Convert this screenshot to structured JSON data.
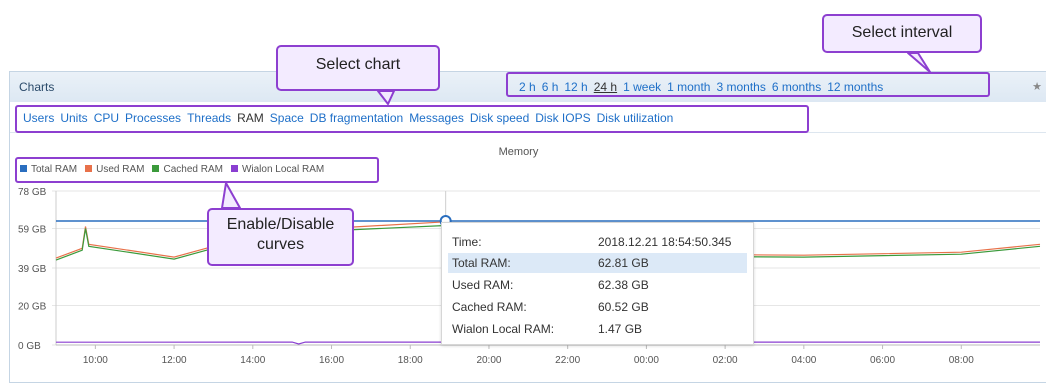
{
  "panel": {
    "title": "Charts",
    "intervals": [
      "2 h",
      "6 h",
      "12 h",
      "24 h",
      "1 week",
      "1 month",
      "3 months",
      "6 months",
      "12 months"
    ],
    "active_interval": "24 h",
    "pin_icon": "pin-icon"
  },
  "tabs": {
    "items": [
      "Users",
      "Units",
      "CPU",
      "Processes",
      "Threads",
      "RAM",
      "Space",
      "DB fragmentation",
      "Messages",
      "Disk speed",
      "Disk IOPS",
      "Disk utilization"
    ],
    "active": "RAM"
  },
  "chart_data": {
    "type": "line",
    "title": "Memory",
    "y_tick_labels": [
      "78 GB",
      "59 GB",
      "39 GB",
      "20 GB",
      "0 GB"
    ],
    "ylim": [
      0,
      78
    ],
    "x_tick_labels": [
      "10:00",
      "12:00",
      "14:00",
      "16:00",
      "18:00",
      "20:00",
      "22:00",
      "00:00",
      "02:00",
      "04:00",
      "06:00",
      "08:00"
    ],
    "x_time_range": [
      "2018.12.20 09:00",
      "2018.12.21 10:00"
    ],
    "legend": [
      "Total RAM",
      "Used RAM",
      "Cached RAM",
      "Wialon Local RAM"
    ],
    "series": [
      {
        "name": "Total RAM",
        "color": "#2a6ebf",
        "points": [
          [
            "09:00",
            62.8
          ],
          [
            "08:00",
            62.8
          ],
          [
            "10:00",
            62.8
          ]
        ]
      },
      {
        "name": "Used RAM",
        "color": "#e8714a",
        "points": [
          [
            "09:00",
            44.0
          ],
          [
            "12:00",
            44.5
          ],
          [
            "13:00",
            50.0
          ],
          [
            "15:00",
            58.0
          ],
          [
            "18:54",
            62.38
          ],
          [
            "21:00",
            47.0
          ],
          [
            "00:00",
            46.0
          ],
          [
            "04:00",
            45.5
          ],
          [
            "08:00",
            47.0
          ],
          [
            "09:40",
            49.0
          ],
          [
            "09:45",
            60.0
          ],
          [
            "09:50",
            51.0
          ],
          [
            "10:00",
            51.0
          ]
        ]
      },
      {
        "name": "Cached RAM",
        "color": "#3b9a3b",
        "points": [
          [
            "09:00",
            43.0
          ],
          [
            "12:00",
            43.5
          ],
          [
            "13:00",
            49.0
          ],
          [
            "15:00",
            57.0
          ],
          [
            "18:54",
            60.52
          ],
          [
            "21:00",
            46.0
          ],
          [
            "00:00",
            45.0
          ],
          [
            "04:00",
            44.5
          ],
          [
            "08:00",
            46.0
          ],
          [
            "09:40",
            48.0
          ],
          [
            "09:45",
            59.0
          ],
          [
            "09:50",
            50.0
          ],
          [
            "10:00",
            50.0
          ]
        ]
      },
      {
        "name": "Wialon Local RAM",
        "color": "#8a3fd1",
        "points": [
          [
            "09:00",
            1.4
          ],
          [
            "15:00",
            1.47
          ],
          [
            "15:10",
            0.5
          ],
          [
            "15:20",
            1.47
          ],
          [
            "18:54",
            1.47
          ],
          [
            "10:00",
            1.47
          ]
        ]
      }
    ]
  },
  "tooltip": {
    "rows": [
      {
        "key": "Time:",
        "value": "2018.12.21 18:54:50.345"
      },
      {
        "key": "Total RAM:",
        "value": "62.81 GB"
      },
      {
        "key": "Used RAM:",
        "value": "62.38 GB"
      },
      {
        "key": "Cached RAM:",
        "value": "60.52 GB"
      },
      {
        "key": "Wialon Local RAM:",
        "value": "1.47 GB"
      }
    ]
  },
  "callouts": {
    "select_interval": "Select interval",
    "select_chart": "Select chart",
    "enable_disable": "Enable/Disable curves"
  },
  "colors": {
    "accent_callout": "#8d3fd0",
    "link": "#1e6fc8"
  }
}
